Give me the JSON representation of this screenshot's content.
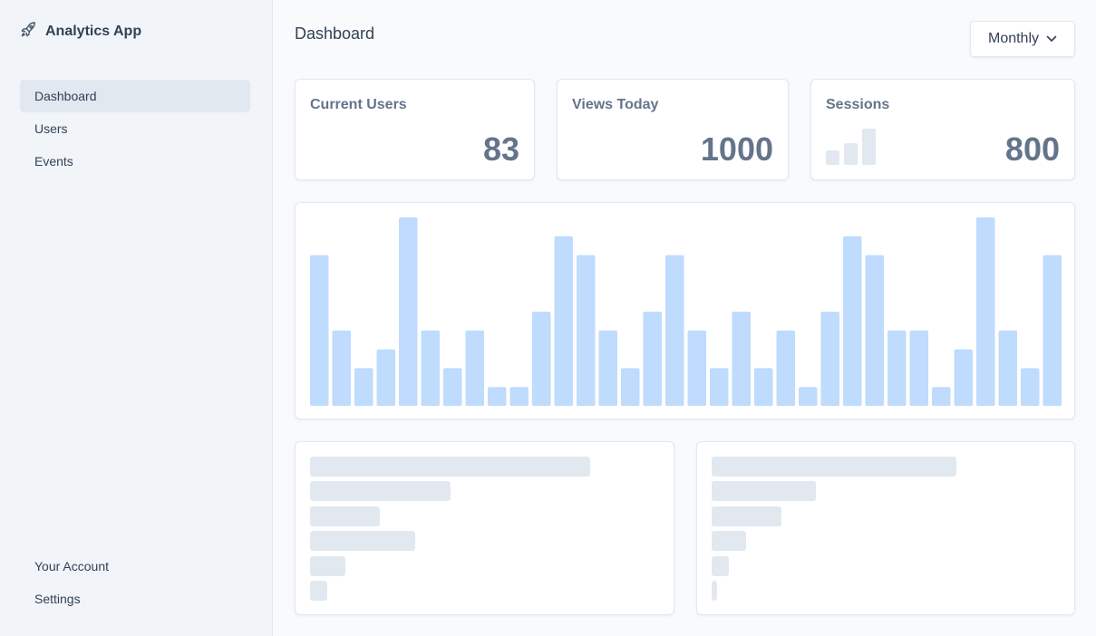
{
  "app": {
    "title": "Analytics App"
  },
  "sidebar": {
    "items": [
      {
        "label": "Dashboard",
        "active": true
      },
      {
        "label": "Users",
        "active": false
      },
      {
        "label": "Events",
        "active": false
      }
    ],
    "bottom_items": [
      {
        "label": "Your Account"
      },
      {
        "label": "Settings"
      }
    ]
  },
  "header": {
    "title": "Dashboard",
    "period_select": {
      "selected": "Monthly"
    }
  },
  "stats": [
    {
      "label": "Current Users",
      "value": "83"
    },
    {
      "label": "Views Today",
      "value": "1000"
    },
    {
      "label": "Sessions",
      "value": "800",
      "sparkline": [
        2,
        3,
        5
      ]
    }
  ],
  "chart_data": {
    "type": "bar",
    "values": [
      8,
      4,
      2,
      3,
      10,
      4,
      2,
      4,
      1,
      1,
      5,
      9,
      8,
      4,
      2,
      5,
      8,
      4,
      2,
      5,
      2,
      4,
      1,
      5,
      9,
      8,
      4,
      4,
      1,
      3,
      10,
      4,
      2,
      8
    ],
    "ylim": [
      0,
      10
    ],
    "grid": false,
    "color": "#bfdbfe"
  },
  "lists": [
    {
      "bars": [
        1.0,
        0.5,
        0.25,
        0.375,
        0.125,
        0.0625
      ]
    },
    {
      "bars": [
        1.0,
        0.425,
        0.285,
        0.14,
        0.07,
        0.022
      ]
    }
  ],
  "colors": {
    "accent": "#bfdbfe",
    "placeholder": "#e2e8f0",
    "sidebar_bg": "#f1f5f9",
    "page_bg": "#f8fafc"
  },
  "icons": {
    "brand": "rocket-icon",
    "select": "chevron-down-icon"
  }
}
